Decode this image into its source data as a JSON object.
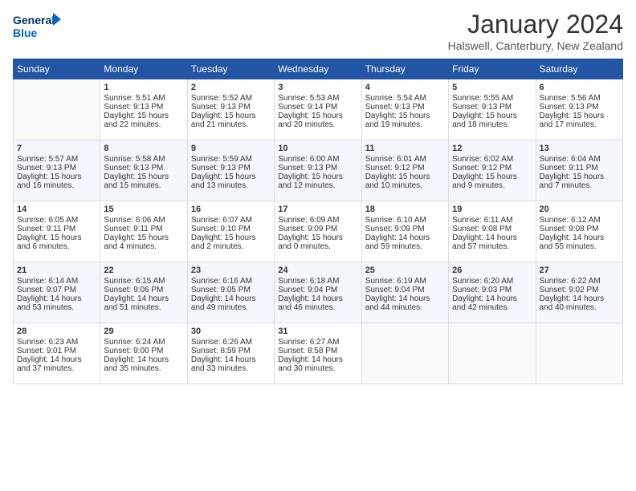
{
  "header": {
    "logo_line1": "General",
    "logo_line2": "Blue",
    "title": "January 2024",
    "subtitle": "Halswell, Canterbury, New Zealand"
  },
  "weekdays": [
    "Sunday",
    "Monday",
    "Tuesday",
    "Wednesday",
    "Thursday",
    "Friday",
    "Saturday"
  ],
  "weeks": [
    [
      {
        "day": "",
        "content": ""
      },
      {
        "day": "1",
        "content": "Sunrise: 5:51 AM\nSunset: 9:13 PM\nDaylight: 15 hours\nand 22 minutes."
      },
      {
        "day": "2",
        "content": "Sunrise: 5:52 AM\nSunset: 9:13 PM\nDaylight: 15 hours\nand 21 minutes."
      },
      {
        "day": "3",
        "content": "Sunrise: 5:53 AM\nSunset: 9:14 PM\nDaylight: 15 hours\nand 20 minutes."
      },
      {
        "day": "4",
        "content": "Sunrise: 5:54 AM\nSunset: 9:13 PM\nDaylight: 15 hours\nand 19 minutes."
      },
      {
        "day": "5",
        "content": "Sunrise: 5:55 AM\nSunset: 9:13 PM\nDaylight: 15 hours\nand 18 minutes."
      },
      {
        "day": "6",
        "content": "Sunrise: 5:56 AM\nSunset: 9:13 PM\nDaylight: 15 hours\nand 17 minutes."
      }
    ],
    [
      {
        "day": "7",
        "content": "Sunrise: 5:57 AM\nSunset: 9:13 PM\nDaylight: 15 hours\nand 16 minutes."
      },
      {
        "day": "8",
        "content": "Sunrise: 5:58 AM\nSunset: 9:13 PM\nDaylight: 15 hours\nand 15 minutes."
      },
      {
        "day": "9",
        "content": "Sunrise: 5:59 AM\nSunset: 9:13 PM\nDaylight: 15 hours\nand 13 minutes."
      },
      {
        "day": "10",
        "content": "Sunrise: 6:00 AM\nSunset: 9:13 PM\nDaylight: 15 hours\nand 12 minutes."
      },
      {
        "day": "11",
        "content": "Sunrise: 6:01 AM\nSunset: 9:12 PM\nDaylight: 15 hours\nand 10 minutes."
      },
      {
        "day": "12",
        "content": "Sunrise: 6:02 AM\nSunset: 9:12 PM\nDaylight: 15 hours\nand 9 minutes."
      },
      {
        "day": "13",
        "content": "Sunrise: 6:04 AM\nSunset: 9:11 PM\nDaylight: 15 hours\nand 7 minutes."
      }
    ],
    [
      {
        "day": "14",
        "content": "Sunrise: 6:05 AM\nSunset: 9:11 PM\nDaylight: 15 hours\nand 6 minutes."
      },
      {
        "day": "15",
        "content": "Sunrise: 6:06 AM\nSunset: 9:11 PM\nDaylight: 15 hours\nand 4 minutes."
      },
      {
        "day": "16",
        "content": "Sunrise: 6:07 AM\nSunset: 9:10 PM\nDaylight: 15 hours\nand 2 minutes."
      },
      {
        "day": "17",
        "content": "Sunrise: 6:09 AM\nSunset: 9:09 PM\nDaylight: 15 hours\nand 0 minutes."
      },
      {
        "day": "18",
        "content": "Sunrise: 6:10 AM\nSunset: 9:09 PM\nDaylight: 14 hours\nand 59 minutes."
      },
      {
        "day": "19",
        "content": "Sunrise: 6:11 AM\nSunset: 9:08 PM\nDaylight: 14 hours\nand 57 minutes."
      },
      {
        "day": "20",
        "content": "Sunrise: 6:12 AM\nSunset: 9:08 PM\nDaylight: 14 hours\nand 55 minutes."
      }
    ],
    [
      {
        "day": "21",
        "content": "Sunrise: 6:14 AM\nSunset: 9:07 PM\nDaylight: 14 hours\nand 53 minutes."
      },
      {
        "day": "22",
        "content": "Sunrise: 6:15 AM\nSunset: 9:06 PM\nDaylight: 14 hours\nand 51 minutes."
      },
      {
        "day": "23",
        "content": "Sunrise: 6:16 AM\nSunset: 9:05 PM\nDaylight: 14 hours\nand 49 minutes."
      },
      {
        "day": "24",
        "content": "Sunrise: 6:18 AM\nSunset: 9:04 PM\nDaylight: 14 hours\nand 46 minutes."
      },
      {
        "day": "25",
        "content": "Sunrise: 6:19 AM\nSunset: 9:04 PM\nDaylight: 14 hours\nand 44 minutes."
      },
      {
        "day": "26",
        "content": "Sunrise: 6:20 AM\nSunset: 9:03 PM\nDaylight: 14 hours\nand 42 minutes."
      },
      {
        "day": "27",
        "content": "Sunrise: 6:22 AM\nSunset: 9:02 PM\nDaylight: 14 hours\nand 40 minutes."
      }
    ],
    [
      {
        "day": "28",
        "content": "Sunrise: 6:23 AM\nSunset: 9:01 PM\nDaylight: 14 hours\nand 37 minutes."
      },
      {
        "day": "29",
        "content": "Sunrise: 6:24 AM\nSunset: 9:00 PM\nDaylight: 14 hours\nand 35 minutes."
      },
      {
        "day": "30",
        "content": "Sunrise: 6:26 AM\nSunset: 8:59 PM\nDaylight: 14 hours\nand 33 minutes."
      },
      {
        "day": "31",
        "content": "Sunrise: 6:27 AM\nSunset: 8:58 PM\nDaylight: 14 hours\nand 30 minutes."
      },
      {
        "day": "",
        "content": ""
      },
      {
        "day": "",
        "content": ""
      },
      {
        "day": "",
        "content": ""
      }
    ]
  ]
}
